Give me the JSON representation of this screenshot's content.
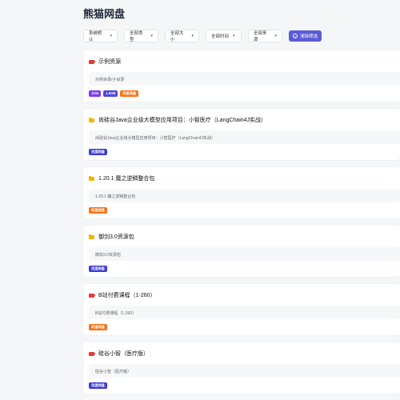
{
  "header": {
    "title": "熊猫网盘"
  },
  "filters": [
    {
      "label": "系统默认"
    },
    {
      "label": "全部类型"
    },
    {
      "label": "全部大小"
    },
    {
      "label": "全部时间"
    },
    {
      "label": "全部来源"
    }
  ],
  "clear_button": {
    "label": "清除筛选"
  },
  "colors": {
    "accent": "#5b5bd6",
    "video": "#e53935",
    "folder": "#f5b400",
    "tag_purple": "#7c3aed",
    "tag_blue": "#4f46e5",
    "tag_orange": "#f97316",
    "tag_indigo": "#3b3bd6"
  },
  "results": [
    {
      "icon": "video-icon",
      "name": "示例资源",
      "path": "示例目录/子目录",
      "tags": [
        {
          "text": "1234",
          "color": "purple"
        },
        {
          "text": "1.5GB",
          "color": "blue"
        },
        {
          "text": "阿里网盘",
          "color": "orange"
        }
      ]
    },
    {
      "icon": "folder-icon",
      "name": "尚硅谷Java企业级大模型应用项目：小智医疗（LangChain4J实战）",
      "path": "尚硅谷Java企业级大模型应用项目：小智医疗（LangChain4J实战）",
      "tags": [
        {
          "text": "百度网盘",
          "color": "indigo"
        }
      ]
    },
    {
      "icon": "folder-icon",
      "name": "1.20.1 魔之逆鳞整合包",
      "path": "1.20.1 魔之逆鳞整合包",
      "tags": [
        {
          "text": "阿里网盘",
          "color": "orange"
        }
      ]
    },
    {
      "icon": "folder-icon",
      "name": "御剑3.0资源包",
      "path": "御剑3.0资源包",
      "tags": [
        {
          "text": "百度网盘",
          "color": "indigo"
        }
      ]
    },
    {
      "icon": "video-icon",
      "name": "B站付费课程（1-260）",
      "path": "B站付费课程（1-260）",
      "tags": [
        {
          "text": "阿里网盘",
          "color": "orange"
        }
      ]
    },
    {
      "icon": "video-icon",
      "name": "硅谷小智（医疗版）",
      "path": "硅谷小智（医疗版）",
      "tags": [
        {
          "text": "百度网盘",
          "color": "indigo"
        }
      ]
    }
  ]
}
